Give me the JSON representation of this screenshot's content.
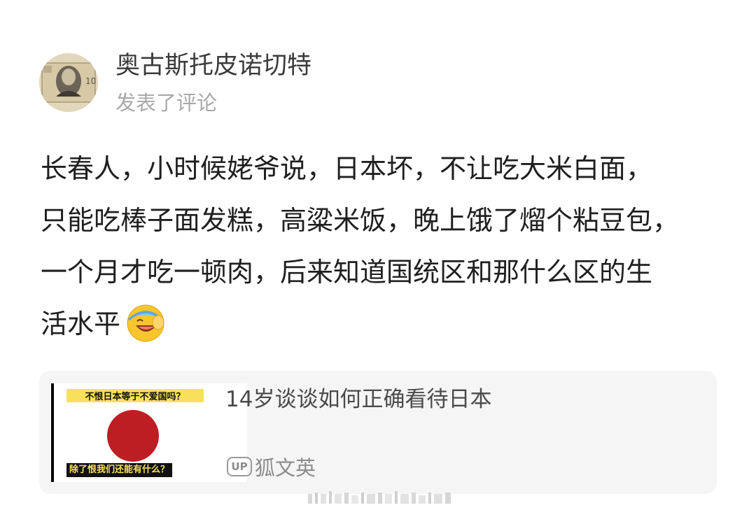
{
  "post": {
    "username": "奥古斯托皮诺切特",
    "action": "发表了评论",
    "avatar": {
      "icon": "banknote-portrait-avatar"
    }
  },
  "comment": {
    "lines": [
      "长春人，小时候姥爷说，日本坏，不让吃大米白面，",
      "只能吃棒子面发糕，高粱米饭，晚上饿了熘个粘豆包，",
      "一个月才吃一顿肉，后来知道国统区和那什么区的生",
      "活水平"
    ],
    "emoji": "laughing-cover-face-emoji"
  },
  "card": {
    "thumbnail": {
      "top_caption": "不恨日本等于不爱国吗？",
      "bottom_caption": "除了恨我们还能有什么？",
      "sun_color": "#bd1e24"
    },
    "title": "14岁谈谈如何正确看待日本",
    "author_badge": "UP",
    "author": "狐文英"
  },
  "colors": {
    "username": "#3b3b3b",
    "meta": "#a8a8a8",
    "body": "#1f1f1f",
    "card_bg": "#f5f5f5"
  }
}
